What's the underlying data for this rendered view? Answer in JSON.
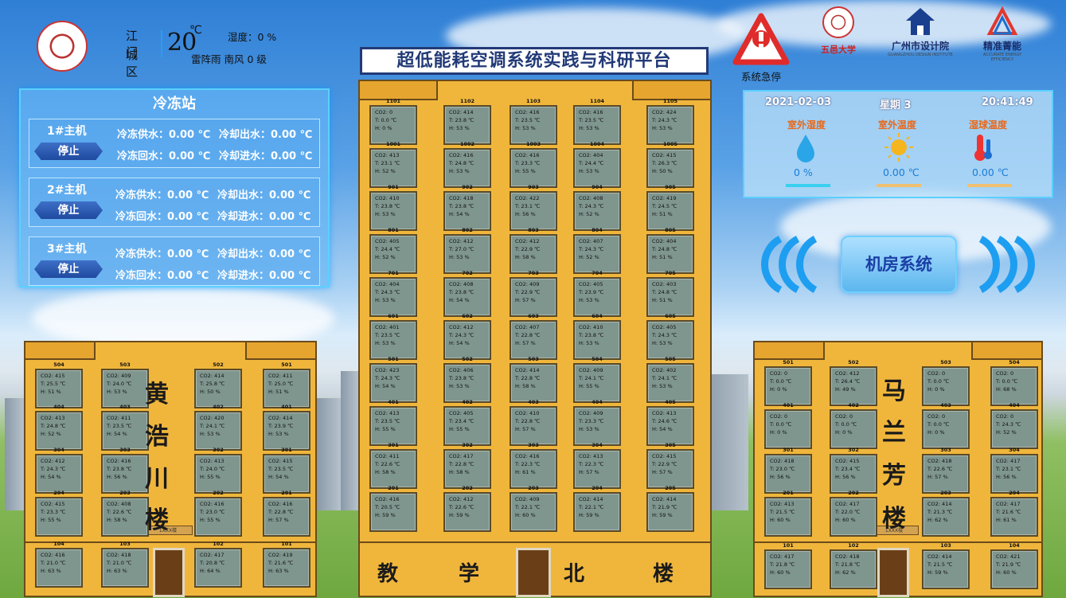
{
  "header": {
    "city": "江门",
    "district": "城区",
    "temperature": "20",
    "temp_unit": "℃",
    "condition": "雷阵雨 南风  0 级",
    "humidity": "湿度：0 %",
    "title": "超低能耗空调系统实践与科研平台",
    "estop_label": "系统急停",
    "brands": [
      {
        "name": "五邑大学"
      },
      {
        "name": "广州市设计院",
        "sub": "GUANGZHOU DESIGN INSTITUTE"
      },
      {
        "name": "精准菁能",
        "sub": "ACCURATE ENERGY EFFICIENCY"
      }
    ]
  },
  "station": {
    "title": "冷冻站",
    "hosts": [
      {
        "name": "1#主机",
        "state": "停止",
        "supply": "冷冻供水：0.00 ℃",
        "ret": "冷冻回水：0.00 ℃",
        "cool_out": "冷却出水：0.00 ℃",
        "cool_in": "冷却进水：0.00 ℃"
      },
      {
        "name": "2#主机",
        "state": "停止",
        "supply": "冷冻供水：0.00 ℃",
        "ret": "冷冻回水：0.00 ℃",
        "cool_out": "冷却出水：0.00 ℃",
        "cool_in": "冷却进水：0.00 ℃"
      },
      {
        "name": "3#主机",
        "state": "停止",
        "supply": "冷冻供水：0.00 ℃",
        "ret": "冷冻回水：0.00 ℃",
        "cool_out": "冷却出水：0.00 ℃",
        "cool_in": "冷却进水：0.00 ℃"
      }
    ]
  },
  "info": {
    "date": "2021-02-03",
    "weekday": "星期 3",
    "time": "20:41:49",
    "metrics": [
      {
        "label": "室外湿度",
        "value": "0 %",
        "icon": "water-drop-icon",
        "color": "#3ad0f0"
      },
      {
        "label": "室外温度",
        "value": "0.00 ℃",
        "icon": "sun-icon",
        "color": "#f0c070"
      },
      {
        "label": "湿球温度",
        "value": "0.00 ℃",
        "icon": "thermometer-icon",
        "color": "#f0c070"
      }
    ]
  },
  "machine_room": "机房系统",
  "buildings": {
    "left": {
      "name": [
        "黄",
        "浩",
        "川",
        "楼"
      ],
      "sign": "1XXX楼",
      "rooms": [
        [
          "504",
          "CO2: 415",
          "T: 25.5 ℃",
          "H: 51 %"
        ],
        [
          "503",
          "CO2: 409",
          "T: 24.0 ℃",
          "H: 53 %"
        ],
        [
          "502",
          "CO2: 414",
          "T: 25.8 ℃",
          "H: 50 %"
        ],
        [
          "501",
          "CO2: 411",
          "T: 25.0 ℃",
          "H: 51 %"
        ],
        [
          "404",
          "CO2: 413",
          "T: 24.8 ℃",
          "H: 52 %"
        ],
        [
          "403",
          "CO2: 411",
          "T: 23.5 ℃",
          "H: 54 %"
        ],
        [
          "402",
          "CO2: 420",
          "T: 24.1 ℃",
          "H: 53 %"
        ],
        [
          "401",
          "CO2: 414",
          "T: 23.9 ℃",
          "H: 53 %"
        ],
        [
          "304",
          "CO2: 412",
          "T: 24.3 ℃",
          "H: 54 %"
        ],
        [
          "303",
          "CO2: 416",
          "T: 23.8 ℃",
          "H: 56 %"
        ],
        [
          "302",
          "CO2: 413",
          "T: 24.0 ℃",
          "H: 55 %"
        ],
        [
          "301",
          "CO2: 415",
          "T: 23.5 ℃",
          "H: 54 %"
        ],
        [
          "204",
          "CO2: 415",
          "T: 23.3 ℃",
          "H: 55 %"
        ],
        [
          "203",
          "CO2: 408",
          "T: 22.6 ℃",
          "H: 58 %"
        ],
        [
          "202",
          "CO2: 416",
          "T: 23.0 ℃",
          "H: 55 %"
        ],
        [
          "201",
          "CO2: 416",
          "T: 22.8 ℃",
          "H: 57 %"
        ],
        [
          "104",
          "CO2: 416",
          "T: 21.0 ℃",
          "H: 63 %"
        ],
        [
          "103",
          "CO2: 418",
          "T: 21.0 ℃",
          "H: 63 %"
        ],
        [
          "102",
          "CO2: 417",
          "T: 20.8 ℃",
          "H: 64 %"
        ],
        [
          "101",
          "CO2: 419",
          "T: 21.6 ℃",
          "H: 63 %"
        ]
      ]
    },
    "center": {
      "name": [
        "教",
        "学",
        "北",
        "楼"
      ],
      "rooms": [
        [
          "1101",
          "CO2: 0",
          "T: 0.0 ℃",
          "H: 0 %"
        ],
        [
          "1102",
          "CO2: 414",
          "T: 23.8 ℃",
          "H: 53 %"
        ],
        [
          "1103",
          "CO2: 416",
          "T: 23.5 ℃",
          "H: 53 %"
        ],
        [
          "1104",
          "CO2: 416",
          "T: 23.5 ℃",
          "H: 53 %"
        ],
        [
          "1105",
          "CO2: 424",
          "T: 24.3 ℃",
          "H: 53 %"
        ],
        [
          "1001",
          "CO2: 413",
          "T: 23.1 ℃",
          "H: 52 %"
        ],
        [
          "1002",
          "CO2: 416",
          "T: 24.8 ℃",
          "H: 53 %"
        ],
        [
          "1003",
          "CO2: 416",
          "T: 23.3 ℃",
          "H: 55 %"
        ],
        [
          "1004",
          "CO2: 404",
          "T: 24.4 ℃",
          "H: 53 %"
        ],
        [
          "1005",
          "CO2: 415",
          "T: 26.3 ℃",
          "H: 50 %"
        ],
        [
          "901",
          "CO2: 410",
          "T: 23.8 ℃",
          "H: 53 %"
        ],
        [
          "902",
          "CO2: 418",
          "T: 23.8 ℃",
          "H: 54 %"
        ],
        [
          "903",
          "CO2: 422",
          "T: 23.1 ℃",
          "H: 56 %"
        ],
        [
          "904",
          "CO2: 408",
          "T: 24.3 ℃",
          "H: 52 %"
        ],
        [
          "905",
          "CO2: 419",
          "T: 24.5 ℃",
          "H: 51 %"
        ],
        [
          "801",
          "CO2: 405",
          "T: 24.4 ℃",
          "H: 52 %"
        ],
        [
          "802",
          "CO2: 412",
          "T: 27.0 ℃",
          "H: 53 %"
        ],
        [
          "803",
          "CO2: 412",
          "T: 22.9 ℃",
          "H: 58 %"
        ],
        [
          "804",
          "CO2: 407",
          "T: 24.3 ℃",
          "H: 52 %"
        ],
        [
          "805",
          "CO2: 404",
          "T: 24.8 ℃",
          "H: 51 %"
        ],
        [
          "701",
          "CO2: 404",
          "T: 24.3 ℃",
          "H: 53 %"
        ],
        [
          "702",
          "CO2: 408",
          "T: 23.8 ℃",
          "H: 54 %"
        ],
        [
          "703",
          "CO2: 409",
          "T: 22.9 ℃",
          "H: 57 %"
        ],
        [
          "704",
          "CO2: 405",
          "T: 23.9 ℃",
          "H: 53 %"
        ],
        [
          "705",
          "CO2: 403",
          "T: 24.8 ℃",
          "H: 51 %"
        ],
        [
          "601",
          "CO2: 401",
          "T: 23.5 ℃",
          "H: 53 %"
        ],
        [
          "602",
          "CO2: 412",
          "T: 24.3 ℃",
          "H: 54 %"
        ],
        [
          "603",
          "CO2: 407",
          "T: 22.8 ℃",
          "H: 57 %"
        ],
        [
          "604",
          "CO2: 410",
          "T: 23.8 ℃",
          "H: 53 %"
        ],
        [
          "605",
          "CO2: 405",
          "T: 24.3 ℃",
          "H: 53 %"
        ],
        [
          "501",
          "CO2: 423",
          "T: 24.3 ℃",
          "H: 54 %"
        ],
        [
          "502",
          "CO2: 406",
          "T: 23.8 ℃",
          "H: 53 %"
        ],
        [
          "503",
          "CO2: 414",
          "T: 22.8 ℃",
          "H: 58 %"
        ],
        [
          "504",
          "CO2: 409",
          "T: 24.1 ℃",
          "H: 55 %"
        ],
        [
          "505",
          "CO2: 402",
          "T: 24.1 ℃",
          "H: 53 %"
        ],
        [
          "401",
          "CO2: 413",
          "T: 23.5 ℃",
          "H: 55 %"
        ],
        [
          "402",
          "CO2: 405",
          "T: 23.4 ℃",
          "H: 55 %"
        ],
        [
          "403",
          "CO2: 410",
          "T: 22.8 ℃",
          "H: 57 %"
        ],
        [
          "404",
          "CO2: 409",
          "T: 23.3 ℃",
          "H: 53 %"
        ],
        [
          "405",
          "CO2: 413",
          "T: 24.6 ℃",
          "H: 54 %"
        ],
        [
          "301",
          "CO2: 411",
          "T: 22.6 ℃",
          "H: 58 %"
        ],
        [
          "302",
          "CO2: 417",
          "T: 22.8 ℃",
          "H: 58 %"
        ],
        [
          "303",
          "CO2: 416",
          "T: 22.3 ℃",
          "H: 61 %"
        ],
        [
          "304",
          "CO2: 413",
          "T: 22.3 ℃",
          "H: 57 %"
        ],
        [
          "305",
          "CO2: 415",
          "T: 22.9 ℃",
          "H: 57 %"
        ],
        [
          "201",
          "CO2: 416",
          "T: 20.5 ℃",
          "H: 59 %"
        ],
        [
          "202",
          "CO2: 412",
          "T: 22.6 ℃",
          "H: 59 %"
        ],
        [
          "203",
          "CO2: 409",
          "T: 22.1 ℃",
          "H: 60 %"
        ],
        [
          "204",
          "CO2: 414",
          "T: 22.1 ℃",
          "H: 59 %"
        ],
        [
          "205",
          "CO2: 414",
          "T: 21.9 ℃",
          "H: 59 %"
        ]
      ]
    },
    "right": {
      "name": [
        "马",
        "兰",
        "芳",
        "楼"
      ],
      "sign": "1XXX楼",
      "rooms": [
        [
          "501",
          "CO2: 0",
          "T: 0.0 ℃",
          "H: 0 %"
        ],
        [
          "502",
          "CO2: 412",
          "T: 26.4 ℃",
          "H: 49 %"
        ],
        [
          "503",
          "CO2: 0",
          "T: 0.0 ℃",
          "H: 0 %"
        ],
        [
          "504",
          "CO2: 0",
          "T: 0.0 ℃",
          "H: 68 %"
        ],
        [
          "401",
          "CO2: 0",
          "T: 0.0 ℃",
          "H: 0 %"
        ],
        [
          "402",
          "CO2: 0",
          "T: 0.0 ℃",
          "H: 0 %"
        ],
        [
          "403",
          "CO2: 0",
          "T: 0.0 ℃",
          "H: 0 %"
        ],
        [
          "404",
          "CO2: 0",
          "T: 24.3 ℃",
          "H: 52 %"
        ],
        [
          "301",
          "CO2: 418",
          "T: 23.0 ℃",
          "H: 56 %"
        ],
        [
          "302",
          "CO2: 415",
          "T: 23.4 ℃",
          "H: 56 %"
        ],
        [
          "303",
          "CO2: 418",
          "T: 22.6 ℃",
          "H: 57 %"
        ],
        [
          "304",
          "CO2: 417",
          "T: 23.1 ℃",
          "H: 56 %"
        ],
        [
          "201",
          "CO2: 413",
          "T: 21.5 ℃",
          "H: 60 %"
        ],
        [
          "202",
          "CO2: 417",
          "T: 22.0 ℃",
          "H: 60 %"
        ],
        [
          "203",
          "CO2: 414",
          "T: 21.3 ℃",
          "H: 62 %"
        ],
        [
          "204",
          "CO2: 417",
          "T: 21.6 ℃",
          "H: 61 %"
        ],
        [
          "101",
          "CO2: 417",
          "T: 21.8 ℃",
          "H: 60 %"
        ],
        [
          "102",
          "CO2: 418",
          "T: 21.8 ℃",
          "H: 62 %"
        ],
        [
          "103",
          "CO2: 414",
          "T: 21.5 ℃",
          "H: 59 %"
        ],
        [
          "104",
          "CO2: 421",
          "T: 21.9 ℃",
          "H: 60 %"
        ]
      ]
    }
  }
}
